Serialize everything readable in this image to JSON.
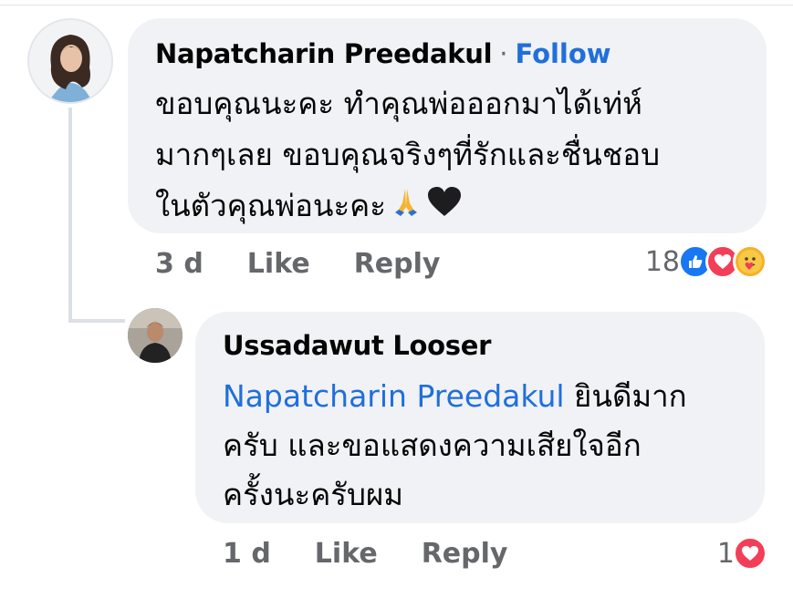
{
  "comment": {
    "author": "Napatcharin Preedakul",
    "separator": "·",
    "follow_label": "Follow",
    "text": "ขอบคุณนะคะ ทำคุณพ่อออกมาได้เท่ห์\nมากๆเลย  ขอบคุณจริงๆที่รักและชื่นชอบ\nในตัวคุณพ่อนะคะ",
    "emojis": [
      "folded-hands",
      "black-heart"
    ],
    "time": "3 d",
    "like_label": "Like",
    "reply_label": "Reply",
    "reaction_count": "18",
    "reactions": [
      "like",
      "love",
      "care"
    ]
  },
  "reply": {
    "author": "Ussadawut Looser",
    "mention": "Napatcharin Preedakul",
    "text": " ยินดีมาก\nครับ และขอแสดงความเสียใจอีก\nครั้งนะครับผม",
    "time": "1 d",
    "like_label": "Like",
    "reply_label": "Reply",
    "reaction_count": "1",
    "reactions": [
      "love"
    ]
  },
  "colors": {
    "link": "#216fdb",
    "bubble": "#f0f2f5",
    "meta": "#65676b",
    "like": "#1877f2",
    "love": "#f33e58",
    "care": "#f7b125"
  }
}
